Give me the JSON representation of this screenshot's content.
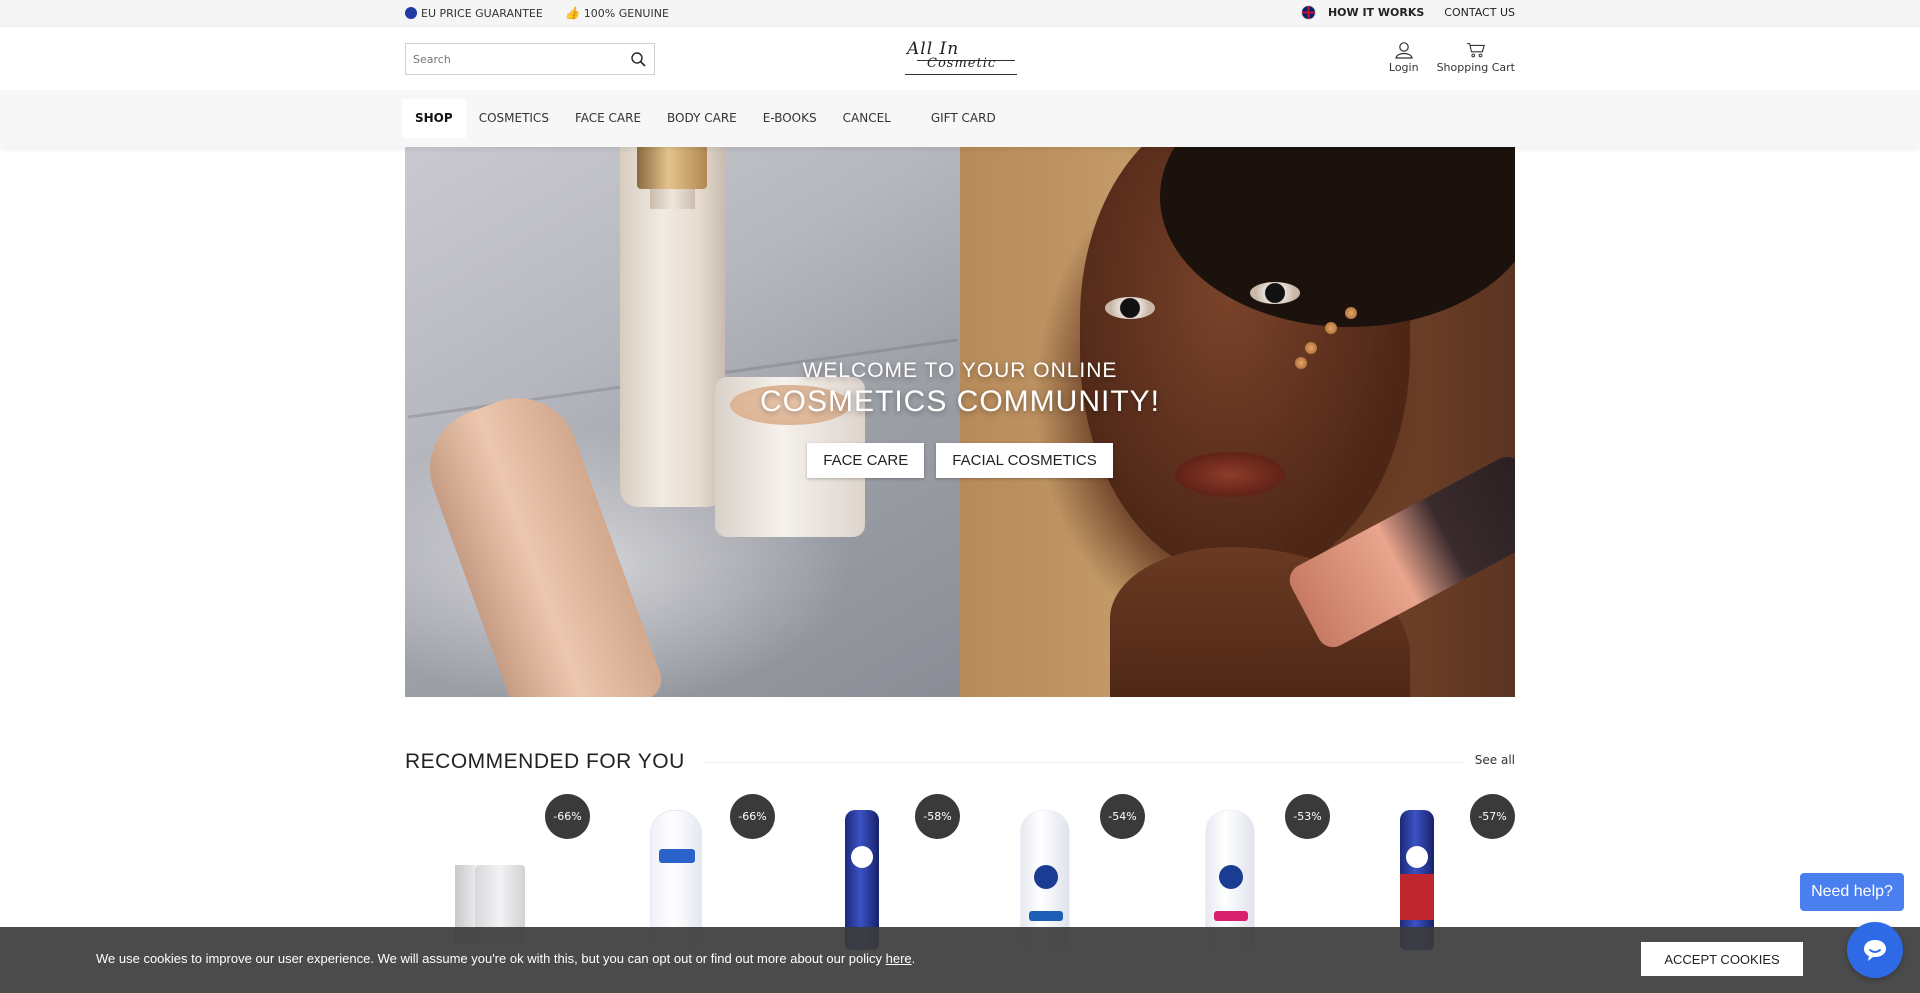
{
  "topbar": {
    "left": [
      {
        "icon": "eu-icon",
        "label": "EU PRICE GUARANTEE"
      },
      {
        "icon": "thumbs-up-icon",
        "label": "100% GENUINE"
      }
    ],
    "right": {
      "language_icon": "uk-flag-icon",
      "how_it_works": "HOW IT WORKS",
      "contact": "CONTACT US"
    }
  },
  "header": {
    "search_placeholder": "Search",
    "logo": {
      "line1": "All In",
      "line2": "Cosmetic"
    },
    "login": "Login",
    "cart": "Shopping Cart"
  },
  "nav": {
    "items": [
      "SHOP",
      "COSMETICS",
      "FACE CARE",
      "BODY CARE",
      "E-BOOKS",
      "CANCEL",
      "GIFT CARD"
    ],
    "active": "SHOP"
  },
  "hero": {
    "line1": "WELCOME TO YOUR ONLINE",
    "line2": "COSMETICS COMMUNITY!",
    "buttons": [
      "FACE CARE",
      "FACIAL COSMETICS"
    ]
  },
  "recommended": {
    "title": "RECOMMENDED FOR YOU",
    "see_all": "See all",
    "products": [
      {
        "discount": "-66%",
        "kind": "cream"
      },
      {
        "discount": "-66%",
        "kind": "lotion"
      },
      {
        "discount": "-58%",
        "kind": "spray-blue"
      },
      {
        "discount": "-54%",
        "kind": "micellar-blue"
      },
      {
        "discount": "-53%",
        "kind": "micellar-pink"
      },
      {
        "discount": "-57%",
        "kind": "spray-red"
      }
    ]
  },
  "cookie": {
    "text": "We use cookies to improve our user experience. We will assume you're ok with this, but you can opt out or find out more about our policy ",
    "link": "here",
    "end": ".",
    "button": "ACCEPT COOKIES"
  },
  "help": {
    "label": "Need help?",
    "chat_icon": "chat-bubble-icon"
  },
  "colors": {
    "accent_blue": "#4a7ff0",
    "badge": "#3a3a3a",
    "cookie_bg": "#3c3c3c"
  }
}
